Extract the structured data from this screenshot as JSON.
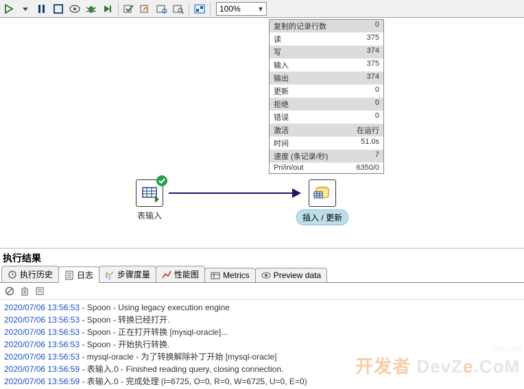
{
  "toolbar": {
    "zoom": "100%"
  },
  "canvas": {
    "node_input_label": "表输入",
    "node_output_label": "插入 / 更新"
  },
  "stats": {
    "rows": [
      {
        "k": "复制的记录行数",
        "v": "0",
        "alt": true
      },
      {
        "k": "读",
        "v": "375",
        "alt": false
      },
      {
        "k": "写",
        "v": "374",
        "alt": true
      },
      {
        "k": "输入",
        "v": "375",
        "alt": false
      },
      {
        "k": "输出",
        "v": "374",
        "alt": true
      },
      {
        "k": "更新",
        "v": "0",
        "alt": false
      },
      {
        "k": "拒绝",
        "v": "0",
        "alt": true
      },
      {
        "k": "错误",
        "v": "0",
        "alt": false
      },
      {
        "k": "激活",
        "v": "在运行",
        "alt": true
      },
      {
        "k": "时间",
        "v": "51.0s",
        "alt": false
      },
      {
        "k": "速度 (条记录/秒)",
        "v": "7",
        "alt": true
      },
      {
        "k": "Pri/in/out",
        "v": "6350/0",
        "alt": false
      }
    ]
  },
  "results": {
    "title": "执行结果",
    "tabs": {
      "history": "执行历史",
      "log": "日志",
      "step_metrics": "步骤度量",
      "perf": "性能图",
      "metrics": "Metrics",
      "preview": "Preview data"
    }
  },
  "log": {
    "lines": [
      {
        "ts": "2020/07/06 13:56:53",
        "msg": " - Spoon - Using legacy execution engine"
      },
      {
        "ts": "2020/07/06 13:56:53",
        "msg": " - Spoon - 转换已经打开."
      },
      {
        "ts": "2020/07/06 13:56:53",
        "msg": " - Spoon - 正在打开转换 [mysql-oracle]..."
      },
      {
        "ts": "2020/07/06 13:56:53",
        "msg": " - Spoon - 开始执行转换."
      },
      {
        "ts": "2020/07/06 13:56:53",
        "msg": " - mysql-oracle - 为了转换解除补丁开始  [mysql-oracle]"
      },
      {
        "ts": "2020/07/06 13:56:59",
        "msg": " - 表输入.0 - Finished reading query, closing connection."
      },
      {
        "ts": "2020/07/06 13:56:59",
        "msg": " - 表输入.0 - 完成处理 (I=6725, O=0, R=0, W=6725, U=0, E=0)"
      }
    ]
  },
  "watermark": {
    "url": "https://bl",
    "brand_pre": "DevZ",
    "brand_mid": "e",
    "brand_post": ".CoM",
    "accent": "开发者"
  }
}
